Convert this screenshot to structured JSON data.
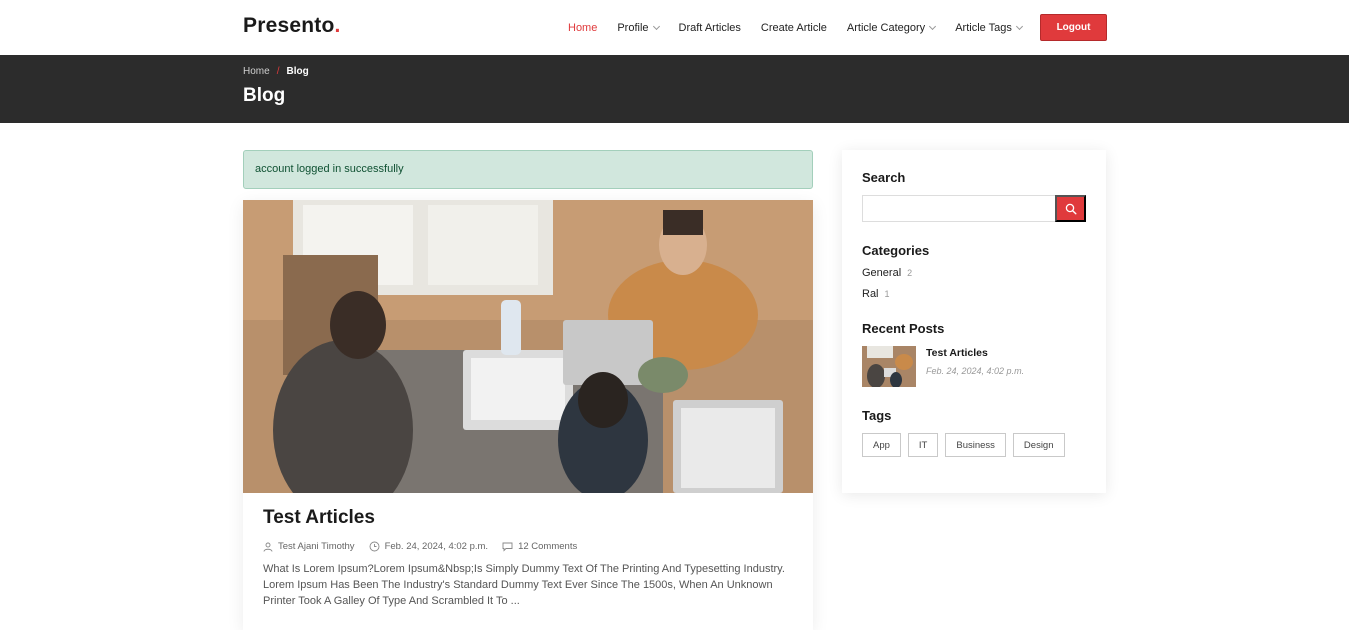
{
  "header": {
    "logo_text": "Presento",
    "logo_dot": ".",
    "nav": [
      {
        "label": "Home",
        "active": true,
        "dropdown": false
      },
      {
        "label": "Profile",
        "active": false,
        "dropdown": true
      },
      {
        "label": "Draft Articles",
        "active": false,
        "dropdown": false
      },
      {
        "label": "Create Article",
        "active": false,
        "dropdown": false
      },
      {
        "label": "Article Category",
        "active": false,
        "dropdown": true
      },
      {
        "label": "Article Tags",
        "active": false,
        "dropdown": true
      }
    ],
    "logout_label": "Logout"
  },
  "titlebar": {
    "breadcrumb_home": "Home",
    "breadcrumb_sep": "/",
    "breadcrumb_current": "Blog",
    "title": "Blog"
  },
  "alert": {
    "text": "account logged in successfully"
  },
  "post": {
    "title": "Test Articles",
    "author": "Test Ajani Timothy",
    "date": "Feb. 24, 2024, 4:02 p.m.",
    "comments": "12 Comments",
    "excerpt": "What Is Lorem Ipsum?Lorem Ipsum&Nbsp;Is Simply Dummy Text Of The Printing And Typesetting Industry. Lorem Ipsum Has Been The Industry's Standard Dummy Text Ever Since The 1500s, When An Unknown Printer Took A Galley Of Type And Scrambled It To ..."
  },
  "sidebar": {
    "search_heading": "Search",
    "search_placeholder": "",
    "categories_heading": "Categories",
    "categories": [
      {
        "name": "General",
        "count": "2"
      },
      {
        "name": "Ral",
        "count": "1"
      }
    ],
    "recent_heading": "Recent Posts",
    "recent_posts": [
      {
        "title": "Test Articles",
        "date": "Feb. 24, 2024, 4:02 p.m."
      }
    ],
    "tags_heading": "Tags",
    "tags": [
      "App",
      "IT",
      "Business",
      "Design"
    ]
  },
  "colors": {
    "accent": "#e03a3c",
    "titlebar": "#2c2c2c",
    "alert_bg": "#d1e7dd"
  }
}
